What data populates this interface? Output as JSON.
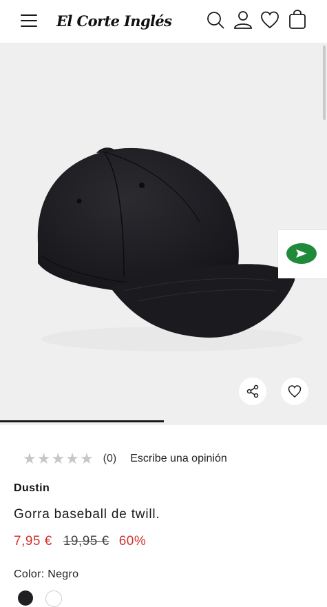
{
  "header": {
    "logo_text": "El Corte Inglés",
    "icons": [
      "menu-icon",
      "search-icon",
      "user-icon",
      "heart-icon",
      "bag-icon"
    ]
  },
  "gallery": {
    "image_alt": "Gorra baseball de twill negra",
    "progress": 0.5
  },
  "rating": {
    "stars": [
      "★",
      "★",
      "★",
      "★",
      "★"
    ],
    "count": "(0)",
    "write_review": "Escribe una opinión"
  },
  "product": {
    "brand": "Dustin",
    "title": "Gorra baseball de twill.",
    "price_current": "7,95 €",
    "price_old": "19,95 €",
    "discount": "60%",
    "color": "Color: Negro"
  },
  "colors": {
    "accent": "#d0312d",
    "widget_green": "#1e8a3a"
  }
}
